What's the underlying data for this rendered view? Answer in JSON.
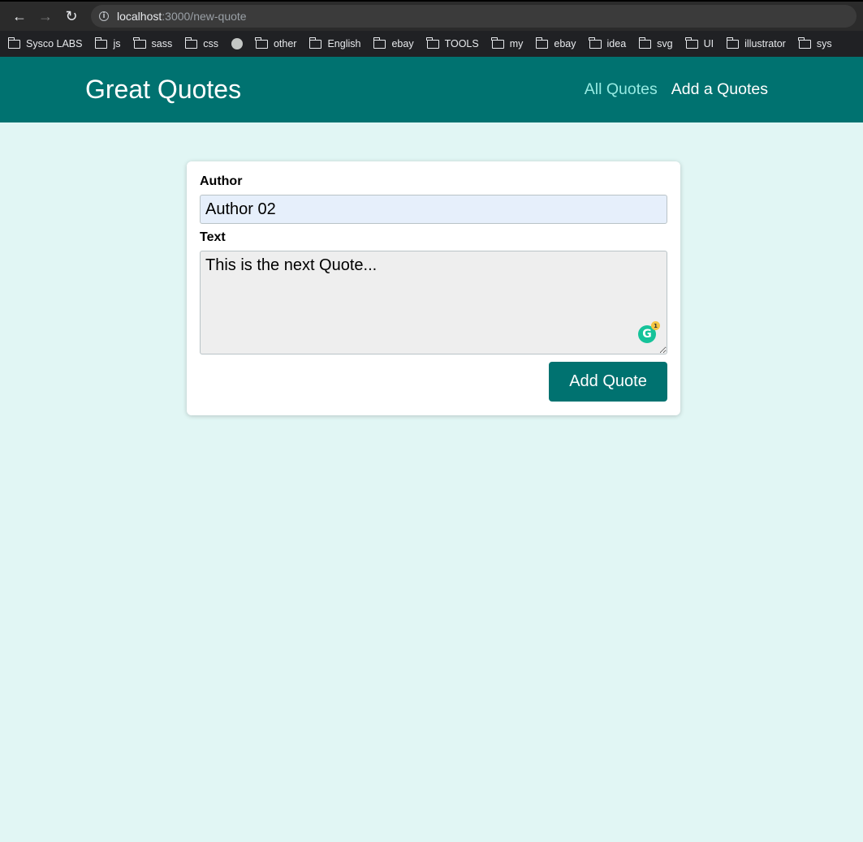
{
  "browser": {
    "url_host": "localhost",
    "url_path": ":3000/new-quote",
    "bookmarks": [
      {
        "label": "Sysco LABS",
        "icon": "folder-icon"
      },
      {
        "label": "js",
        "icon": "folder-icon"
      },
      {
        "label": "sass",
        "icon": "folder-icon"
      },
      {
        "label": "css",
        "icon": "folder-icon"
      },
      {
        "label": "",
        "icon": "globe-icon"
      },
      {
        "label": "other",
        "icon": "folder-icon"
      },
      {
        "label": "English",
        "icon": "folder-icon"
      },
      {
        "label": "ebay",
        "icon": "folder-icon"
      },
      {
        "label": "TOOLS",
        "icon": "folder-icon"
      },
      {
        "label": "my",
        "icon": "folder-icon"
      },
      {
        "label": "ebay",
        "icon": "folder-icon"
      },
      {
        "label": "idea",
        "icon": "folder-icon"
      },
      {
        "label": "svg",
        "icon": "folder-icon"
      },
      {
        "label": "UI",
        "icon": "folder-icon"
      },
      {
        "label": "illustrator",
        "icon": "folder-icon"
      },
      {
        "label": "sys",
        "icon": "folder-icon"
      }
    ]
  },
  "header": {
    "brand": "Great Quotes",
    "nav": [
      {
        "label": "All Quotes",
        "active": true
      },
      {
        "label": "Add a Quotes",
        "active": false
      }
    ]
  },
  "form": {
    "author_label": "Author",
    "author_value": "Author 02",
    "text_label": "Text",
    "text_value": "This is the next Quote...",
    "grammarly_count": "1",
    "submit_label": "Add Quote"
  },
  "colors": {
    "header_bg": "#007270",
    "page_bg": "#e1f6f4",
    "active_link": "#95eae2",
    "button_bg": "#007270"
  }
}
